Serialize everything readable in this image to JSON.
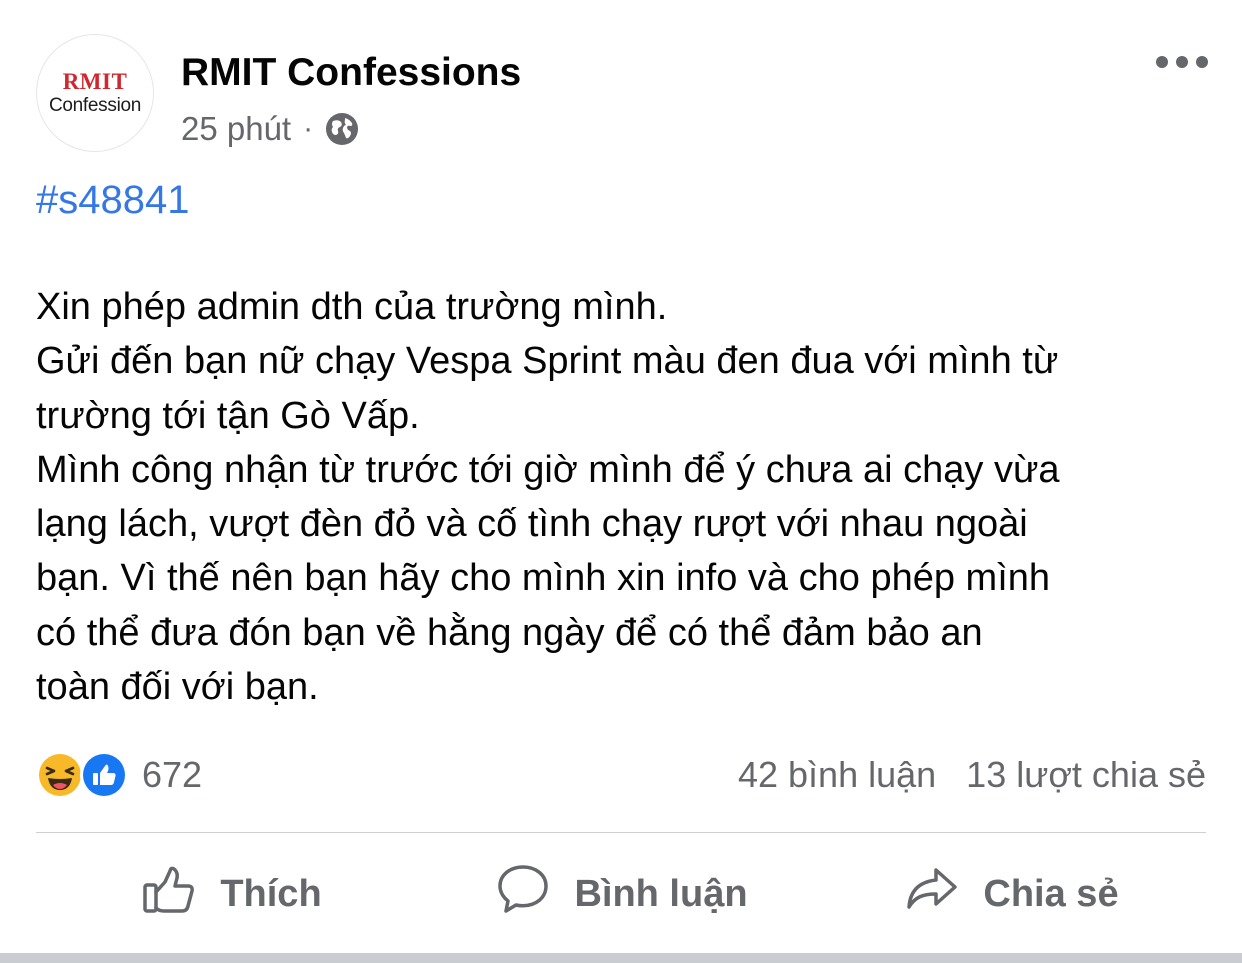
{
  "page": {
    "name": "RMIT Confessions",
    "avatar_logo_top": "RMIT",
    "avatar_logo_bottom": "Confession",
    "timestamp": "25 phút",
    "separator": "·",
    "privacy_icon": "globe-icon",
    "more_icon": "more-horizontal-icon"
  },
  "post": {
    "hashtag": "#s48841",
    "lines": [
      "Xin phép admin dth của trường mình.",
      "Gửi đến bạn nữ chạy Vespa Sprint màu đen đua với mình từ",
      "trường tới tận Gò Vấp.",
      "Mình công nhận từ trước tới giờ mình để ý chưa ai chạy vừa",
      "lạng lách, vượt đèn đỏ và cố tình chạy rượt với nhau ngoài",
      "bạn. Vì thế nên bạn hãy cho mình xin info và cho phép mình",
      "có thể đưa đón bạn về hằng ngày để có thể đảm bảo an",
      "toàn đối với bạn."
    ]
  },
  "stats": {
    "reaction_icons": [
      "haha-icon",
      "like-icon"
    ],
    "reaction_count": "672",
    "comments": "42 bình luận",
    "shares": "13 lượt chia sẻ"
  },
  "actions": {
    "like": {
      "label": "Thích",
      "icon": "thumbs-up-icon"
    },
    "comment": {
      "label": "Bình luận",
      "icon": "comment-bubble-icon"
    },
    "share": {
      "label": "Chia sẻ",
      "icon": "share-arrow-icon"
    }
  },
  "colors": {
    "hashtag": "#3578e5",
    "secondary_text": "#65676b",
    "like_blue": "#1877f2",
    "haha_yellow": "#f7b928",
    "logo_red": "#d0262e"
  }
}
